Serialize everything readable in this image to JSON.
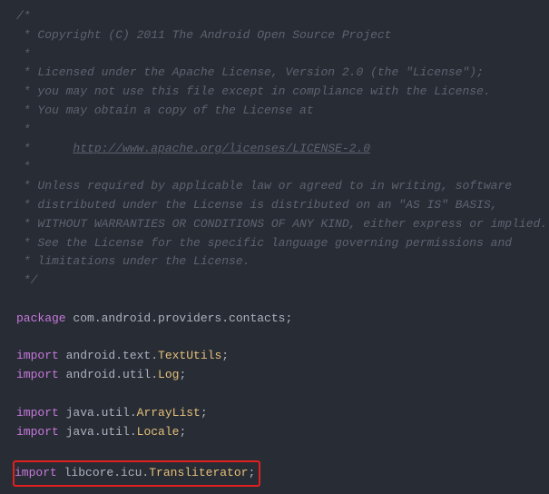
{
  "comment": {
    "l1": "/*",
    "l2": " * Copyright (C) 2011 The Android Open Source Project",
    "l3": " *",
    "l4": " * Licensed under the Apache License, Version 2.0 (the \"License\");",
    "l5": " * you may not use this file except in compliance with the License.",
    "l6": " * You may obtain a copy of the License at",
    "l7": " *",
    "l8a": " *      ",
    "l8b": "http://www.apache.org/licenses/LICENSE-2.0",
    "l9": " *",
    "l10": " * Unless required by applicable law or agreed to in writing, software",
    "l11": " * distributed under the License is distributed on an \"AS IS\" BASIS,",
    "l12": " * WITHOUT WARRANTIES OR CONDITIONS OF ANY KIND, either express or implied.",
    "l13": " * See the License for the specific language governing permissions and",
    "l14": " * limitations under the License.",
    "l15": " */"
  },
  "kw": {
    "package": "package",
    "import": "import"
  },
  "pkg": {
    "package_name": " com.android.providers.contacts",
    "imp1a": " android.text.",
    "imp1b": "TextUtils",
    "imp2a": " android.util.",
    "imp2b": "Log",
    "imp3a": " java.util.",
    "imp3b": "ArrayList",
    "imp4a": " java.util.",
    "imp4b": "Locale",
    "imp5a": " libcore.icu.",
    "imp5b": "Transliterator"
  },
  "semi": ";"
}
